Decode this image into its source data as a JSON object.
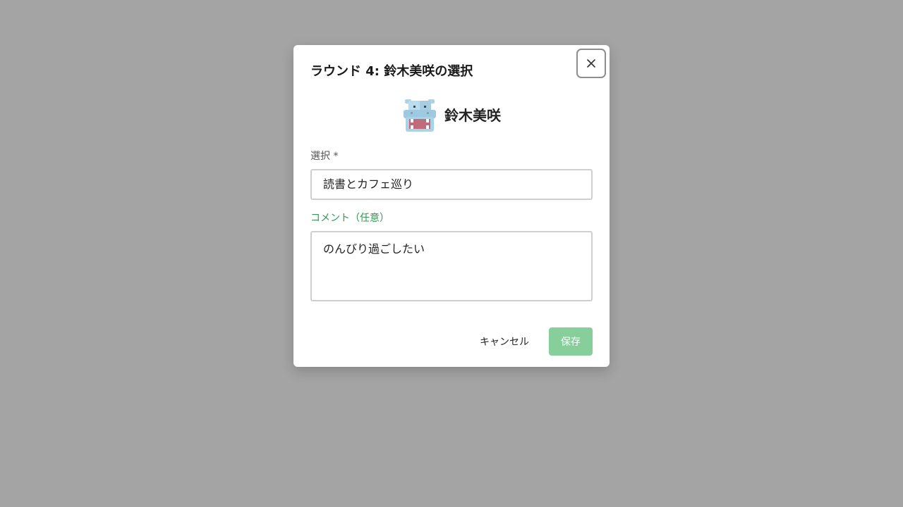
{
  "dialog": {
    "title": "ラウンド 4: 鈴木美咲の選択",
    "close_icon": "close-icon",
    "person": {
      "avatar_icon": "hippo-avatar-icon",
      "name": "鈴木美咲"
    },
    "selection": {
      "label": "選択 *",
      "value": "読書とカフェ巡り"
    },
    "comment": {
      "label": "コメント（任意）",
      "value": "のんびり過ごしたい"
    },
    "buttons": {
      "cancel": "キャンセル",
      "save": "保存"
    }
  },
  "colors": {
    "backdrop": "#a4a4a4",
    "accent_green": "#2e9a4f",
    "save_button_disabled": "#86cf9b"
  }
}
